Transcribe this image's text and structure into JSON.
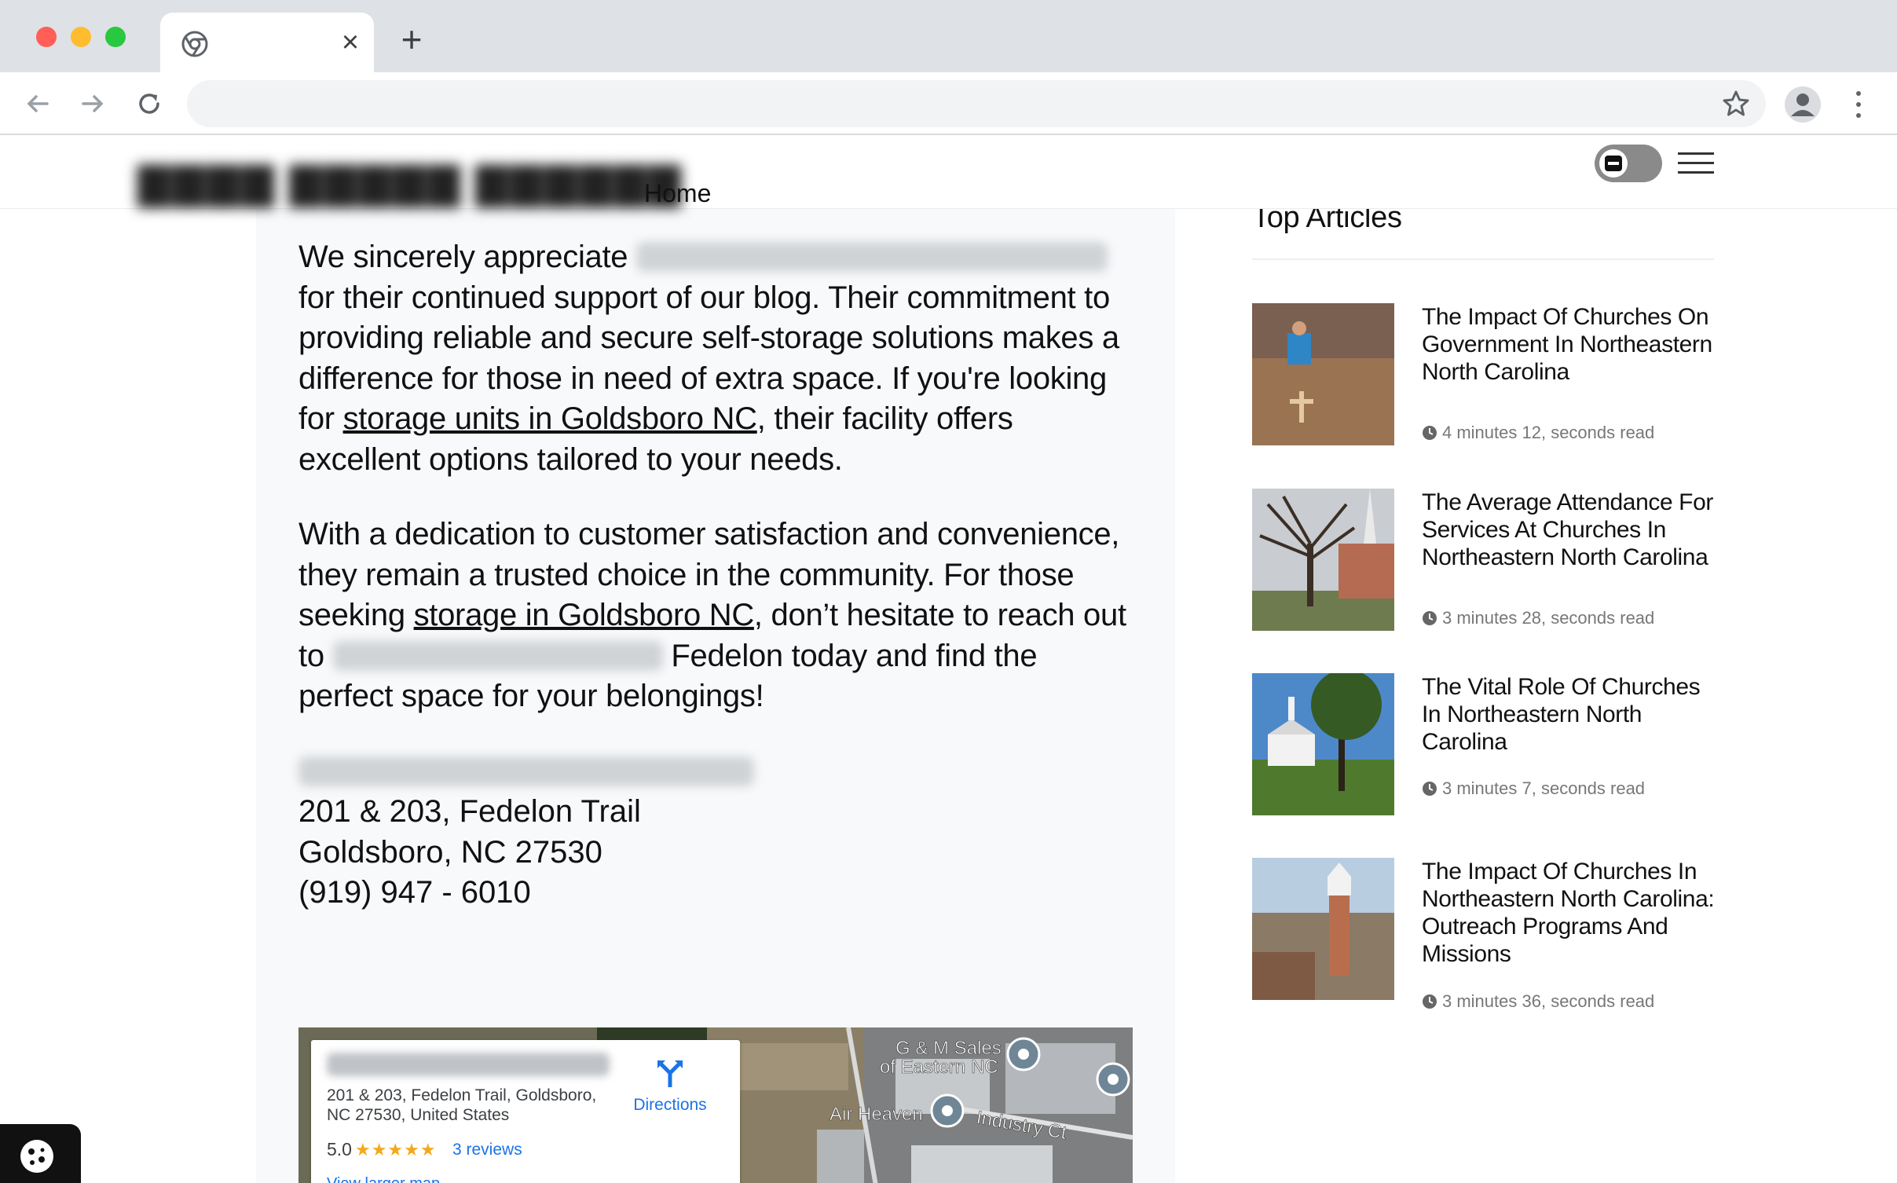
{
  "browser": {
    "tab_title": "",
    "tab_close_icon": "close-icon",
    "new_tab_icon": "plus-icon",
    "url": "",
    "icons": [
      "arrow-left-icon",
      "arrow-right-icon",
      "reload-icon",
      "star-icon",
      "profile-icon",
      "kebab-menu-icon"
    ]
  },
  "header": {
    "nav_home": "Home"
  },
  "article": {
    "p1_before": "We sincerely appreciate ",
    "p1_after": " for their continued support of our blog. Their commitment to providing reliable and secure self-storage solutions makes a difference for those in need of extra space. If you're looking for ",
    "p1_link": "storage units in Goldsboro NC",
    "p1_end": ", their facility offers excellent options tailored to your needs.",
    "p2_before": "With a dedication to customer satisfaction and convenience, they remain a trusted choice in the community. For those seeking ",
    "p2_link": "storage in Goldsboro NC",
    "p2_mid": ", don’t hesitate to reach out to ",
    "p2_end": " Fedelon today and find the perfect space for your belongings!",
    "address_street": "201 & 203, Fedelon Trail",
    "address_city": "Goldsboro, NC 27530",
    "address_phone": "(919) 947 - 6010"
  },
  "map": {
    "card_address": "201 & 203, Fedelon Trail, Goldsboro, NC 27530, United States",
    "rating": "5.0",
    "stars": "★★★★★",
    "reviews": "3 reviews",
    "directions": "Directions",
    "view_larger": "View larger map",
    "label_gm": "G & M Sales",
    "label_gm2": "of Eastern NC",
    "label_air": "Air Heaven",
    "label_industry": "Industry Ct"
  },
  "sidebar": {
    "title": "Top Articles",
    "articles": [
      {
        "title": "The Impact Of Churches On Government In Northeastern North Carolina",
        "read_time": "4 minutes 12, seconds read"
      },
      {
        "title": "The Average Attendance For Services At Churches In Northeastern North Carolina",
        "read_time": "3 minutes 28, seconds read"
      },
      {
        "title": "The Vital Role Of Churches In Northeastern North Carolina",
        "read_time": "3 minutes 7, seconds read"
      },
      {
        "title": "The Impact Of Churches In Northeastern North Carolina: Outreach Programs And Missions",
        "read_time": "3 minutes 36, seconds read"
      }
    ]
  },
  "colors": {
    "link_blue": "#1a73e8",
    "star_gold": "#f4a81c",
    "article_bg": "#f8f9fb"
  }
}
